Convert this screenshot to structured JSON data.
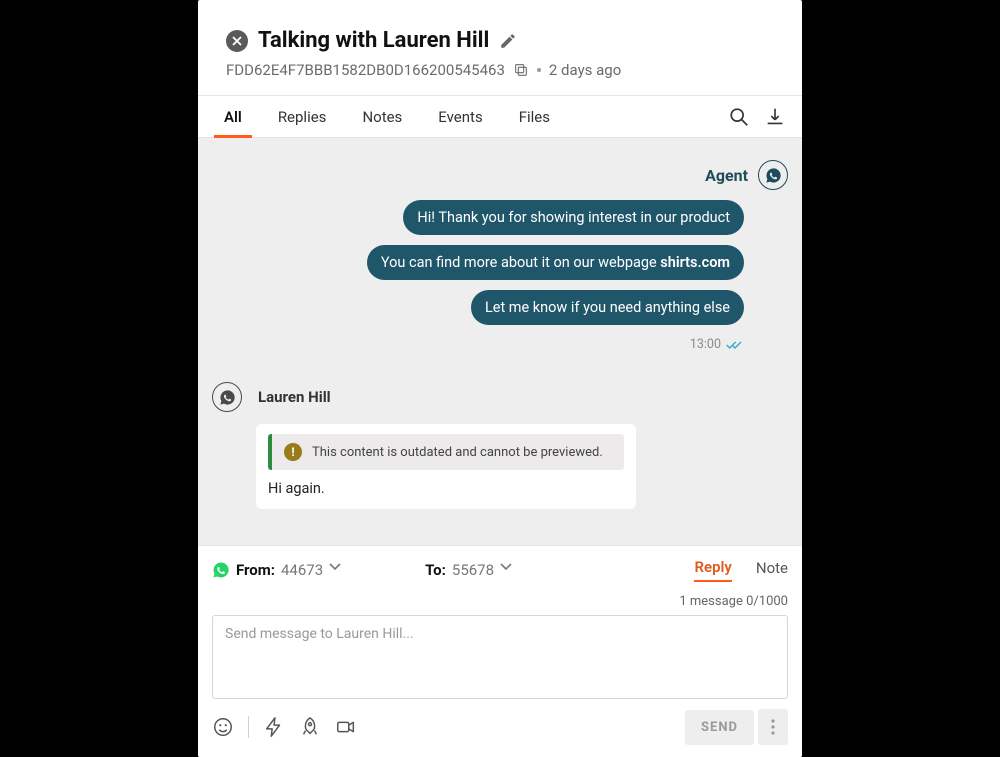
{
  "header": {
    "title": "Talking with Lauren Hill",
    "id": "FDD62E4F7BBB1582DB0D166200545463",
    "age": "2 days ago"
  },
  "tabs": {
    "all": "All",
    "replies": "Replies",
    "notes": "Notes",
    "events": "Events",
    "files": "Files"
  },
  "chat": {
    "agent_label": "Agent",
    "msg1": "Hi! Thank you for showing interest in our product",
    "msg2_pre": "You can find more about it on our webpage ",
    "msg2_link": "shirts.com",
    "msg3": "Let me know if you need anything else",
    "time": "13:00",
    "customer_label": "Lauren Hill",
    "warning": "This content is outdated and cannot be previewed.",
    "customer_msg": "Hi again."
  },
  "composer": {
    "from_label": "From:",
    "from_value": "44673",
    "to_label": "To:",
    "to_value": "55678",
    "tab_reply": "Reply",
    "tab_note": "Note",
    "counter": "1 message 0/1000",
    "placeholder": "Send message to Lauren Hill...",
    "send": "SEND"
  }
}
